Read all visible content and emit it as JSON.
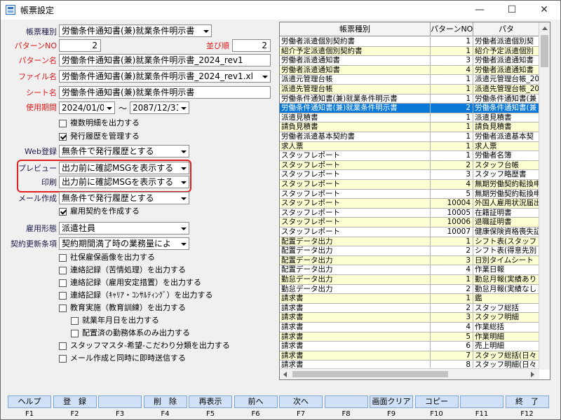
{
  "window": {
    "title": "帳票設定",
    "minimize": "—",
    "maximize": "☐",
    "close": "✕"
  },
  "form": {
    "labels": {
      "type": "帳票種別",
      "pattern_no": "パターンNO",
      "order": "並び順",
      "pattern_name": "パターン名",
      "file_name": "ファイル名",
      "sheet_name": "シート名",
      "period": "使用期間",
      "web": "Web登録",
      "preview": "プレビュー",
      "print": "印刷",
      "mail": "メール作成",
      "employment_type": "雇用形態",
      "renewal": "契約更新条項"
    },
    "type_value": "労働条件通知書(兼)就業条件明示書",
    "pattern_no": "2",
    "order": "2",
    "pattern_name": "労働条件通知書(兼)就業条件明示書_2024_rev1",
    "file_name": "労働条件通知書(兼)就業条件明示書_2024_rev1.xl",
    "sheet_name": "労働条件通知書(兼)就業条件明示書",
    "period_from": "2024/01/01",
    "period_sep": "〜",
    "period_to": "2087/12/31",
    "web_value": "無条件で発行履歴とする",
    "preview_value": "出力前に確認MSGを表示する",
    "print_value": "出力前に確認MSGを表示する",
    "mail_value": "無条件で発行履歴とする",
    "employment_type_value": "派遣社員",
    "renewal_value": "契約期間満了時の業務量によ",
    "checks": [
      {
        "label": "複数明細を出力する",
        "checked": false
      },
      {
        "label": "発行履歴を管理する",
        "checked": true
      },
      {
        "label": "雇用契約を作成する",
        "checked": true
      },
      {
        "label": "社保雇保画像を出力する",
        "checked": false
      },
      {
        "label": "連絡記録（苦情処理）を出力する",
        "checked": false
      },
      {
        "label": "連絡記録（雇用安定措置）を出力する",
        "checked": false
      },
      {
        "label": "連絡記録（ｷｬﾘｱ・ｺﾝｻﾙﾃｨﾝｸﾞ）を出力する",
        "checked": false
      },
      {
        "label": "教育実施（教育訓練）を出力する",
        "checked": false
      },
      {
        "label": "就業年月日を出力する",
        "checked": false
      },
      {
        "label": "配置済の勤務体系のみ出力する",
        "checked": false
      },
      {
        "label": "スタッフマスタ-希望-こだわり分類を出力する",
        "checked": false
      },
      {
        "label": "メール作成と同時に即時送信する",
        "checked": false
      }
    ]
  },
  "grid": {
    "headers": [
      "帳票種別",
      "パターンNO",
      "パタ"
    ],
    "rows": [
      {
        "type": "労働者派遣個別契約書",
        "no": "1",
        "pattern": "労働者派遣個別契",
        "style": "w"
      },
      {
        "type": "紹介予定派遣個別契約書",
        "no": "1",
        "pattern": "紹介予定派遣個別",
        "style": "y"
      },
      {
        "type": "労働者派遣通知書",
        "no": "3",
        "pattern": "労働者派遣通知書",
        "style": "w"
      },
      {
        "type": "労働者派遣通知書",
        "no": "4",
        "pattern": "労働者派遣通知書",
        "style": "y"
      },
      {
        "type": "派遣元管理台帳",
        "no": "1",
        "pattern": "派遣元管理台帳_20",
        "style": "w"
      },
      {
        "type": "派遣先管理台帳",
        "no": "1",
        "pattern": "派遣先管理台帳_20",
        "style": "y"
      },
      {
        "type": "労働条件通知書(兼)就業条件明示書",
        "no": "1",
        "pattern": "労働条件通知書(兼",
        "style": "w"
      },
      {
        "type": "労働条件通知書(兼)就業条件明示書",
        "no": "2",
        "pattern": "労働条件通知書(兼",
        "style": "sl"
      },
      {
        "type": "派遣見積書",
        "no": "1",
        "pattern": "派遣見積書",
        "style": "w"
      },
      {
        "type": "請負見積書",
        "no": "1",
        "pattern": "請負見積書",
        "style": "y"
      },
      {
        "type": "労働者派遣基本契約書",
        "no": "1",
        "pattern": "労働者派遣基本契",
        "style": "w"
      },
      {
        "type": "求人票",
        "no": "1",
        "pattern": "求人票",
        "style": "y"
      },
      {
        "type": "スタッフレポート",
        "no": "1",
        "pattern": "労働者名簿",
        "style": "w"
      },
      {
        "type": "スタッフレポート",
        "no": "2",
        "pattern": "スタッフ台帳",
        "style": "y"
      },
      {
        "type": "スタッフレポート",
        "no": "3",
        "pattern": "スタッフ略歴書",
        "style": "w"
      },
      {
        "type": "スタッフレポート",
        "no": "4",
        "pattern": "無期労働契約転換申",
        "style": "y"
      },
      {
        "type": "スタッフレポート",
        "no": "5",
        "pattern": "無期労働契約転換申",
        "style": "w"
      },
      {
        "type": "スタッフレポート",
        "no": "10004",
        "pattern": "外国人雇用状況届出",
        "style": "y"
      },
      {
        "type": "スタッフレポート",
        "no": "10005",
        "pattern": "在籍証明書",
        "style": "w"
      },
      {
        "type": "スタッフレポート",
        "no": "10006",
        "pattern": "退職証明書",
        "style": "y"
      },
      {
        "type": "スタッフレポート",
        "no": "10007",
        "pattern": "健康保険資格喪失証",
        "style": "w"
      },
      {
        "type": "配置データ出力",
        "no": "1",
        "pattern": "シフト表(スタッフ",
        "style": "y"
      },
      {
        "type": "配置データ出力",
        "no": "2",
        "pattern": "シフト表(得意先別",
        "style": "w"
      },
      {
        "type": "配置データ出力",
        "no": "3",
        "pattern": "日別タイムシート",
        "style": "y"
      },
      {
        "type": "配置データ出力",
        "no": "4",
        "pattern": "作業日報",
        "style": "w"
      },
      {
        "type": "勤怠データ出力",
        "no": "1",
        "pattern": "勤怠月報(実績あり",
        "style": "y"
      },
      {
        "type": "勤怠データ出力",
        "no": "2",
        "pattern": "勤怠月報(実績なし",
        "style": "w"
      },
      {
        "type": "請求書",
        "no": "1",
        "pattern": "鑑",
        "style": "y"
      },
      {
        "type": "請求書",
        "no": "2",
        "pattern": "スタッフ総括",
        "style": "w"
      },
      {
        "type": "請求書",
        "no": "3",
        "pattern": "スタッフ明細",
        "style": "y"
      },
      {
        "type": "請求書",
        "no": "4",
        "pattern": "作業総括",
        "style": "w"
      },
      {
        "type": "請求書",
        "no": "5",
        "pattern": "作業明細",
        "style": "y"
      },
      {
        "type": "請求書",
        "no": "6",
        "pattern": "売上明細",
        "style": "w"
      },
      {
        "type": "請求書",
        "no": "7",
        "pattern": "スタッフ総括(日々",
        "style": "y"
      },
      {
        "type": "請求書",
        "no": "8",
        "pattern": "スタッフ明細(日々",
        "style": "w"
      }
    ]
  },
  "fkeys": [
    {
      "label": "ヘルプ",
      "key": "F1"
    },
    {
      "label": "登　録",
      "key": "F2"
    },
    {
      "label": "",
      "key": "F3"
    },
    {
      "label": "削　除",
      "key": "F4"
    },
    {
      "label": "再表示",
      "key": "F5"
    },
    {
      "label": "前へ",
      "key": "F6"
    },
    {
      "label": "次へ",
      "key": "F7"
    },
    {
      "label": "",
      "key": "F8"
    },
    {
      "label": "画面クリア",
      "key": "F9"
    },
    {
      "label": "コピー",
      "key": "F10"
    },
    {
      "label": "",
      "key": "F11"
    },
    {
      "label": "終　了",
      "key": "F12"
    }
  ]
}
